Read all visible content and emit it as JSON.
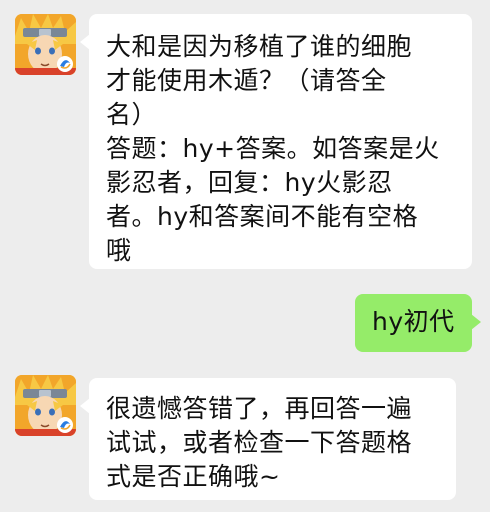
{
  "chat": {
    "messages": [
      {
        "sender": "bot",
        "avatar_icon": "naruto-avatar-icon",
        "lines": [
          "大和是因为移植了谁的细胞",
          "才能使用木遁？（请答全",
          "名）",
          "答题：hy+答案。如答案是火",
          "影忍者，回复：hy火影忍",
          "者。hy和答案间不能有空格",
          "哦"
        ]
      },
      {
        "sender": "user",
        "lines": [
          "hy初代"
        ]
      },
      {
        "sender": "bot",
        "avatar_icon": "naruto-avatar-icon",
        "lines": [
          "很遗憾答错了，再回答一遍",
          "试试，或者检查一下答题格",
          "式是否正确哦~"
        ]
      }
    ]
  },
  "colors": {
    "background": "#ededed",
    "incoming_bubble": "#ffffff",
    "outgoing_bubble": "#95ec69",
    "text": "#111111"
  }
}
